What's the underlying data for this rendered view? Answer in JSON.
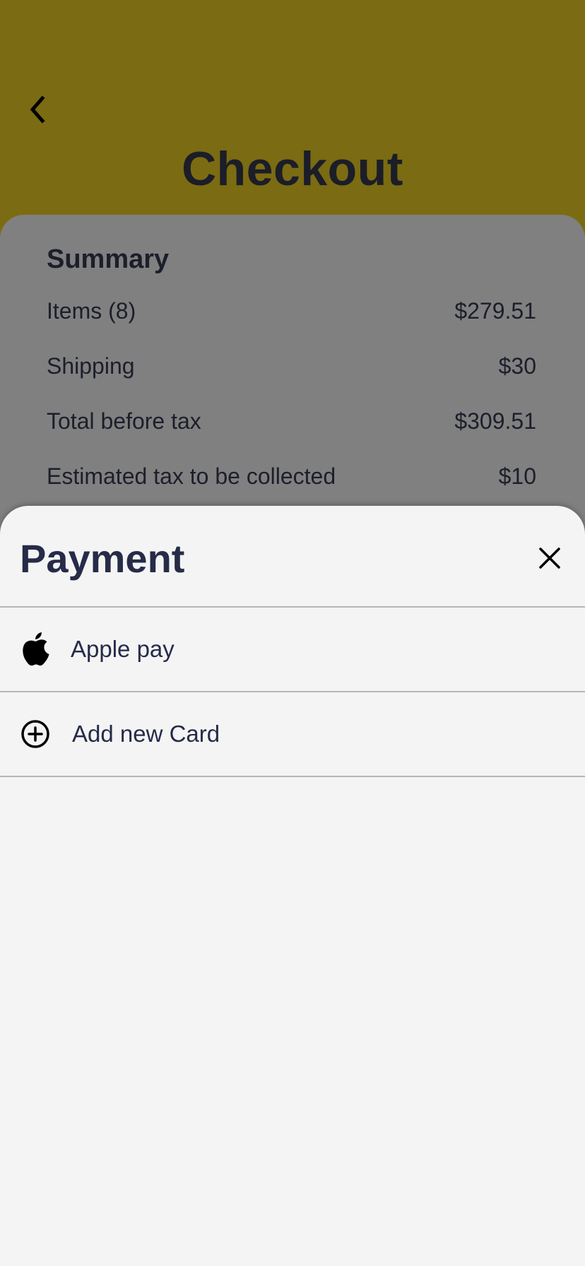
{
  "header": {
    "title": "Checkout",
    "back_icon": "chevron-left-icon"
  },
  "summary": {
    "heading": "Summary",
    "rows": [
      {
        "label": "Items (8)",
        "value": "$279.51"
      },
      {
        "label": "Shipping",
        "value": "$30"
      },
      {
        "label": "Total before tax",
        "value": "$309.51"
      },
      {
        "label": "Estimated tax to be collected",
        "value": "$10"
      }
    ]
  },
  "payment_sheet": {
    "title": "Payment",
    "close_icon": "close-icon",
    "options": [
      {
        "label": "Apple pay",
        "icon": "apple-icon"
      },
      {
        "label": "Add new Card",
        "icon": "add-circle-icon"
      }
    ]
  },
  "colors": {
    "header_bg": "#7b6b12",
    "dimmed_card": "#808080",
    "sheet_bg": "#f4f4f4",
    "title_text": "#262b48"
  }
}
